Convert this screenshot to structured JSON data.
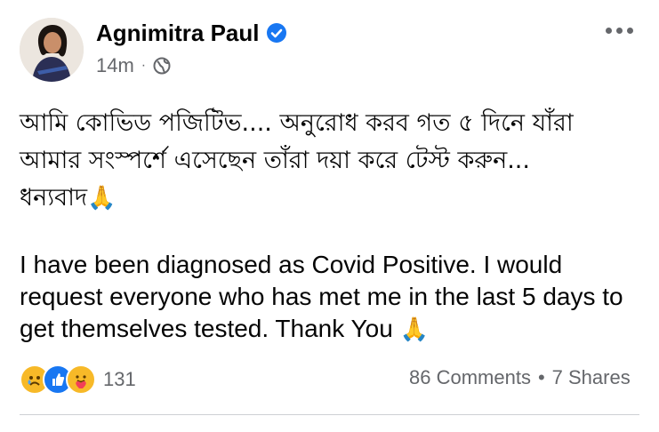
{
  "author": {
    "name": "Agnimitra Paul",
    "verified": true
  },
  "meta": {
    "time": "14m",
    "separator": "·",
    "audience_icon": "globe-icon"
  },
  "post": {
    "bengali_line1": "আমি কোভিড পজিটিভ.... অনুরোধ করব গত ৫ দিনে যাঁরা",
    "bengali_line2": "আমার সংস্পর্শে এসেছেন তাঁরা দয়া করে টেস্ট করুন...",
    "bengali_line3": "ধন্যবাদ",
    "english_line1": "I have been diagnosed as Covid Positive. I would",
    "english_line2": "request everyone who has met me in the last 5 days to",
    "english_line3": "get themselves tested. Thank You",
    "emoji": "🙏"
  },
  "reactions": {
    "icons": [
      "sad-reaction-icon",
      "like-reaction-icon",
      "care-reaction-icon"
    ],
    "count": "131"
  },
  "stats": {
    "comments": "86 Comments",
    "separator": "•",
    "shares": "7 Shares"
  },
  "colors": {
    "verified": "#1877f2",
    "secondary_text": "#65676b",
    "divider": "#ced0d4"
  }
}
